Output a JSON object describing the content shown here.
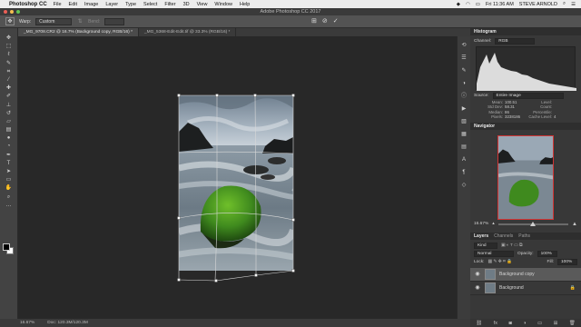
{
  "menubar": {
    "apple": "",
    "app": "Photoshop CC",
    "items": [
      "File",
      "Edit",
      "Image",
      "Layer",
      "Type",
      "Select",
      "Filter",
      "3D",
      "View",
      "Window",
      "Help"
    ],
    "clock": "Fri 11:36 AM",
    "user": "STEVE ARNOLD",
    "status_icons": [
      "dropbox-icon",
      "wifi-icon",
      "battery-icon",
      "search-icon",
      "list-icon"
    ]
  },
  "titlebar": {
    "title": "Adobe Photoshop CC 2017"
  },
  "options": {
    "warp_label": "Warp:",
    "warp_value": "Custom",
    "bend_label": "Bend:",
    "commit": "✓",
    "cancel": "⊘"
  },
  "tabs": [
    {
      "label": "_MG_9708.CR2 @ 16.7% (Background copy, RGB/16) *",
      "active": true
    },
    {
      "label": "_MG_5368-Edit-Edit.tif @ 33.3% (RGB/16) *",
      "active": false
    }
  ],
  "status": {
    "zoom": "16.67%",
    "doc": "Doc: 120.3M/120.3M"
  },
  "histogram": {
    "title": "Histogram",
    "channel_label": "Channel:",
    "channel": "RGB",
    "source_label": "Source:",
    "source": "Entire Image",
    "stats": [
      [
        "Mean:",
        "100.51",
        "Level:",
        ""
      ],
      [
        "Std Dev:",
        "58.31",
        "Count:",
        ""
      ],
      [
        "Median:",
        "86",
        "Percentile:",
        ""
      ],
      [
        "Pixels:",
        "3238186",
        "Cache Level:",
        "4"
      ]
    ]
  },
  "navigator": {
    "title": "Navigator",
    "zoom": "16.67%"
  },
  "layers": {
    "tabs": [
      "Layers",
      "Channels",
      "Paths"
    ],
    "kind": "Kind",
    "blend_mode": "Normal",
    "opacity_label": "Opacity:",
    "opacity": "100%",
    "lock_label": "Lock:",
    "fill_label": "Fill:",
    "fill": "100%",
    "items": [
      {
        "name": "Background copy",
        "selected": true
      },
      {
        "name": "Background",
        "selected": false
      }
    ]
  },
  "colors": {
    "accent": "#d03535",
    "panel": "#383838",
    "canvas": "#282828",
    "moss": "#3f8a1e"
  }
}
